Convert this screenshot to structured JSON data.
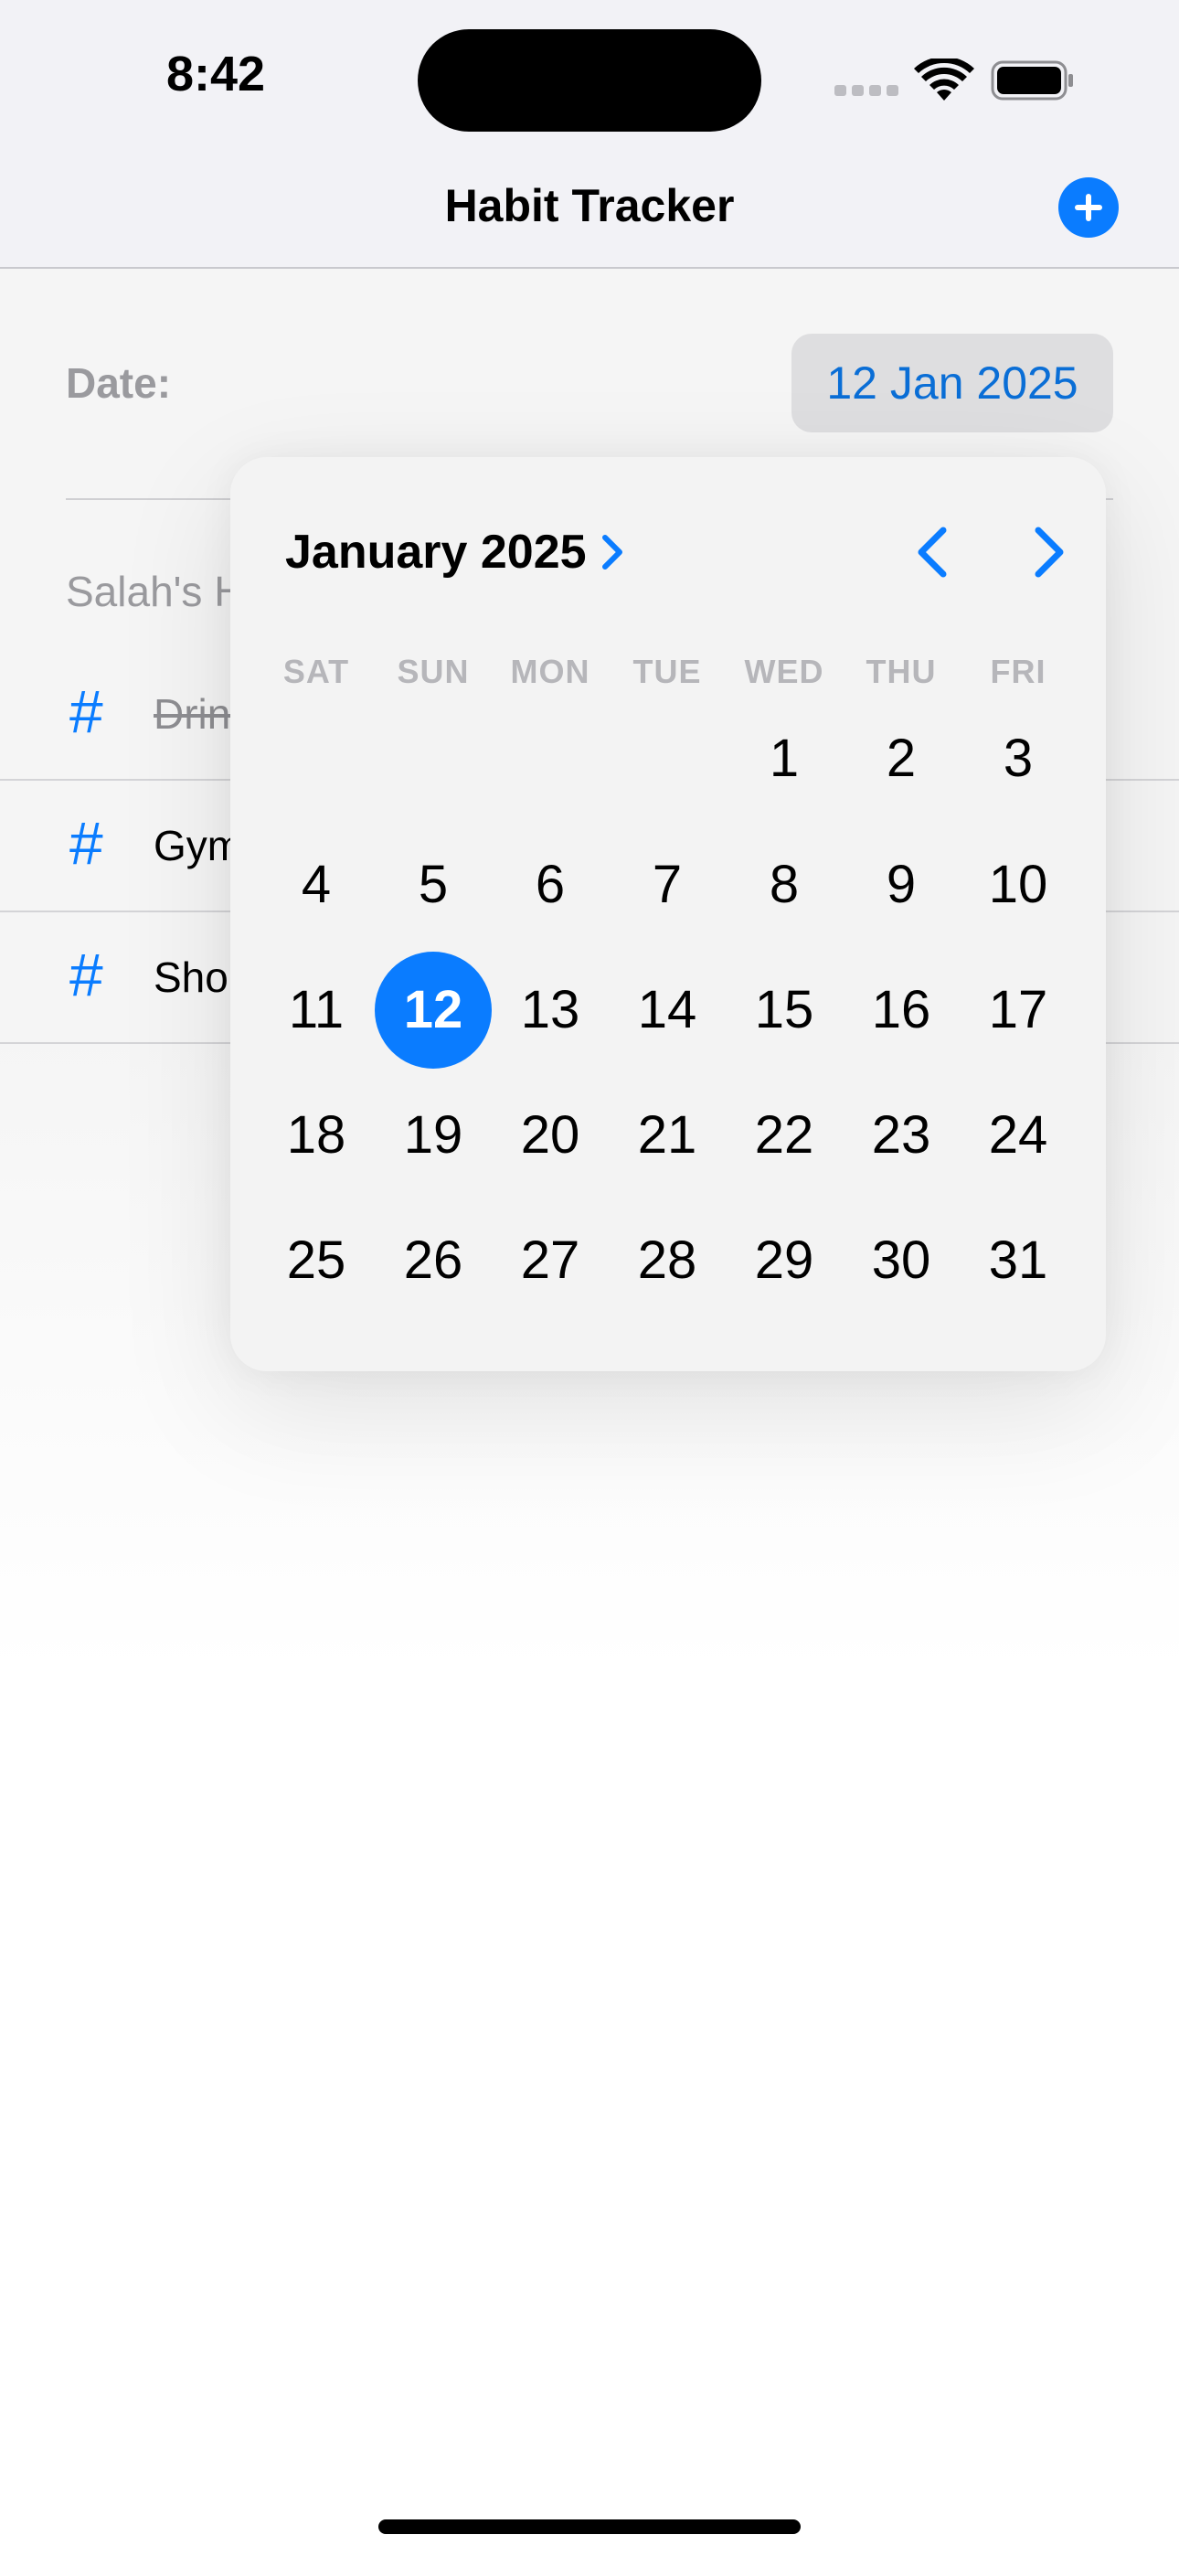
{
  "status_bar": {
    "time": "8:42"
  },
  "nav": {
    "title": "Habit Tracker",
    "add_icon": "plus-circle-icon"
  },
  "form": {
    "date_label": "Date:",
    "date_value": "12 Jan 2025",
    "section_title": "Salah's H"
  },
  "habits": [
    {
      "icon": "hash-icon",
      "name": "Drink",
      "completed": true
    },
    {
      "icon": "hash-icon",
      "name": "Gym",
      "completed": false
    },
    {
      "icon": "hash-icon",
      "name": "Sho",
      "completed": false
    }
  ],
  "calendar": {
    "month_label": "January 2025",
    "weekdays": [
      "SAT",
      "SUN",
      "MON",
      "TUE",
      "WED",
      "THU",
      "FRI"
    ],
    "leading_blanks": 4,
    "days_in_month": 31,
    "selected_day": 12
  },
  "colors": {
    "accent": "#0a7cff",
    "popover_bg": "#f3f3f3"
  }
}
